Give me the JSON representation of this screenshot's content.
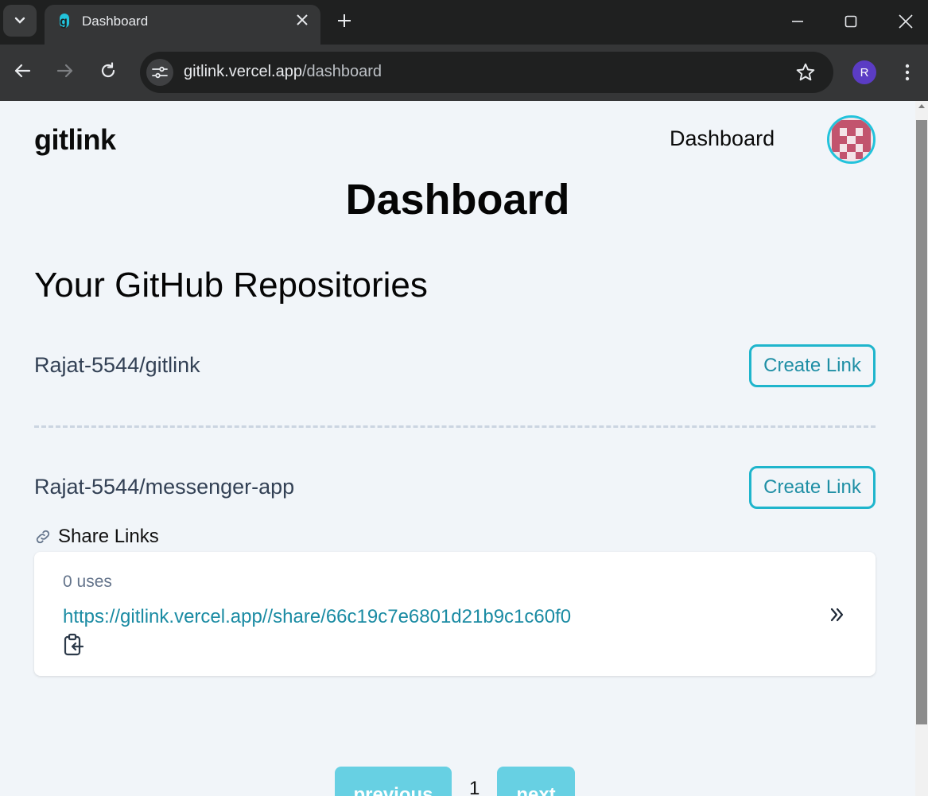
{
  "browser": {
    "tab_title": "Dashboard",
    "url_host": "gitlink.vercel.app",
    "url_path": "/dashboard",
    "profile_initial": "R"
  },
  "header": {
    "logo_g": "g",
    "logo_rest": "itlink",
    "nav_link": "Dashboard"
  },
  "page": {
    "title": "Dashboard",
    "section_title": "Your GitHub Repositories"
  },
  "repos": [
    {
      "name": "Rajat-5544/gitlink",
      "button": "Create Link"
    },
    {
      "name": "Rajat-5544/messenger-app",
      "button": "Create Link"
    }
  ],
  "share": {
    "heading": "Share Links",
    "links": [
      {
        "uses": "0 uses",
        "url": "https://gitlink.vercel.app//share/66c19c7e6801d21b9c1c60f0"
      }
    ]
  },
  "pagination": {
    "previous": "previous",
    "page": "1",
    "next": "next"
  },
  "colors": {
    "accent": "#22c3dc",
    "button_border": "#1fb5cc",
    "link": "#1a8ba3",
    "pager_bg": "#67d0e3"
  }
}
